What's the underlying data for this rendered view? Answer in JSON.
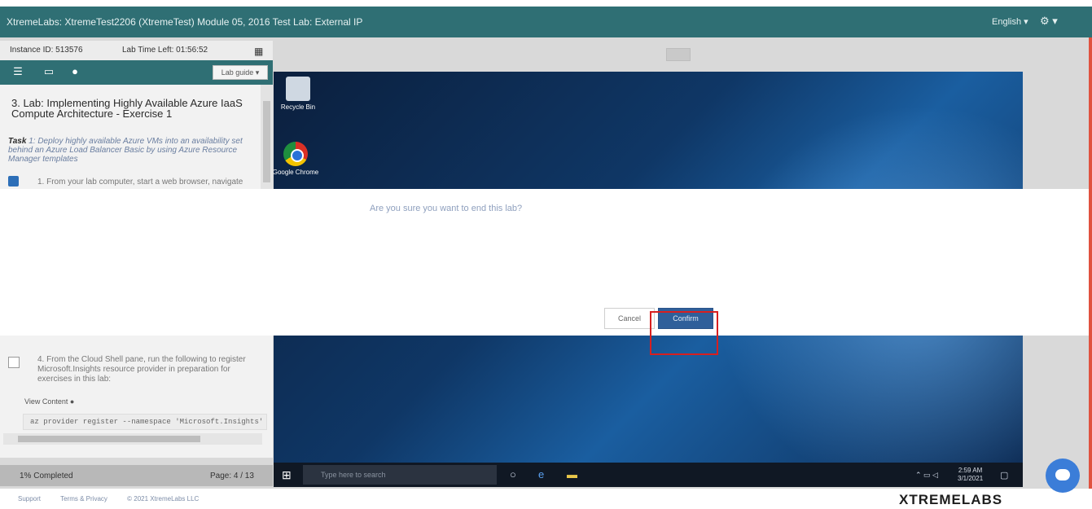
{
  "window": {
    "title": "XtremeLabs: XtremeTest2206 (XtremeTest) Module 05, 2016 Test Lab: External IP",
    "language_menu": "English ▾",
    "user_menu": "⚙ ▾"
  },
  "left_panel": {
    "instance_id": "Instance ID: 513576",
    "time_left": "Lab Time Left: 01:56:52",
    "language_button": "Lab guide ▾",
    "lab_title": "3. Lab: Implementing Highly Available Azure IaaS Compute Architecture - Exercise 1",
    "task_label": "Task",
    "task_text": "1: Deploy highly available Azure VMs into an availability set behind an Azure Load Balancer Basic by using Azure Resource Manager templates",
    "step1": "1. From your lab computer, start a web browser, navigate",
    "step4": "4. From the Cloud Shell pane, run the following to register Microsoft.Insights resource provider in preparation for exercises in this lab:",
    "view_content": "View Content ●",
    "code": "az provider register --namespace 'Microsoft.Insights'",
    "progress": "1% Completed",
    "page": "Page: 4 / 13"
  },
  "vm": {
    "desktop_icons": [
      "Recycle Bin",
      "Google Chrome"
    ],
    "search_placeholder": "Type here to search",
    "clock_time": "2:59 AM",
    "clock_date": "3/1/2021"
  },
  "dialog": {
    "message": "Are you sure you want to end this lab?",
    "cancel_label": "Cancel",
    "confirm_label": "Confirm"
  },
  "footer": {
    "links": [
      "Support",
      "Terms & Privacy",
      "© 2021 XtremeLabs LLC"
    ],
    "brand": "XTREMELABS"
  },
  "colors": {
    "header_teal": "#2f6f74",
    "confirm_blue": "#2f5f9a",
    "highlight_red": "#d81f1f"
  }
}
